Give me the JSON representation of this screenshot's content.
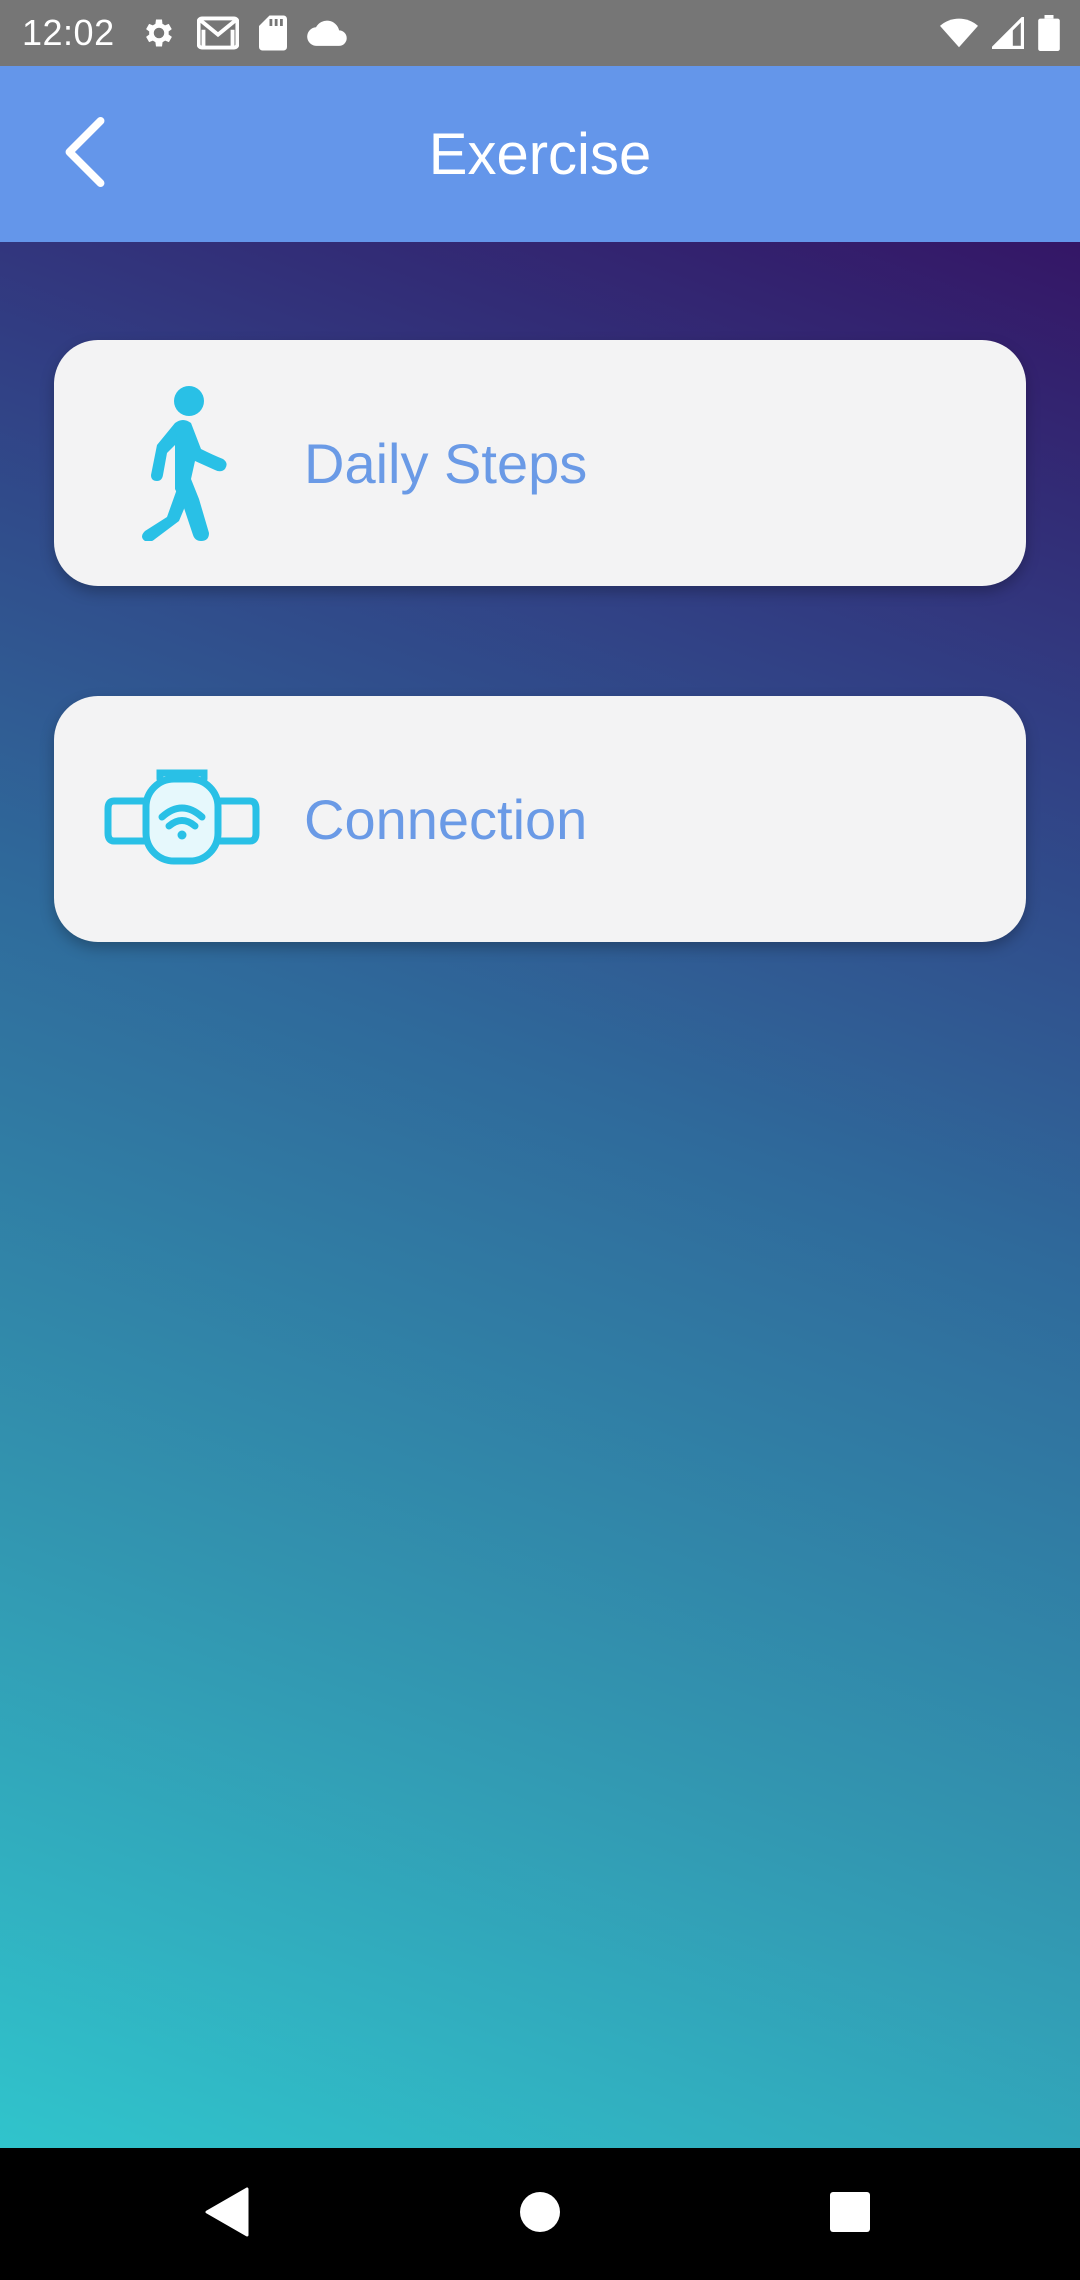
{
  "status_bar": {
    "time": "12:02",
    "left_icons": [
      "gear-icon",
      "gmail-icon",
      "sd-card-icon",
      "cloud-icon"
    ],
    "right_icons": [
      "wifi-icon",
      "cell-signal-icon",
      "battery-icon"
    ]
  },
  "app_bar": {
    "title": "Exercise",
    "back_icon": "chevron-left-icon",
    "color": "#6496ea"
  },
  "menu": {
    "items": [
      {
        "label": "Daily Steps",
        "icon": "walking-person-icon"
      },
      {
        "label": "Connection",
        "icon": "wearable-wifi-device-icon"
      }
    ],
    "label_color": "#6a9ae6",
    "icon_color": "#29c0e6"
  },
  "nav_bar": {
    "buttons": [
      "back-triangle-icon",
      "home-circle-icon",
      "recents-square-icon"
    ]
  }
}
